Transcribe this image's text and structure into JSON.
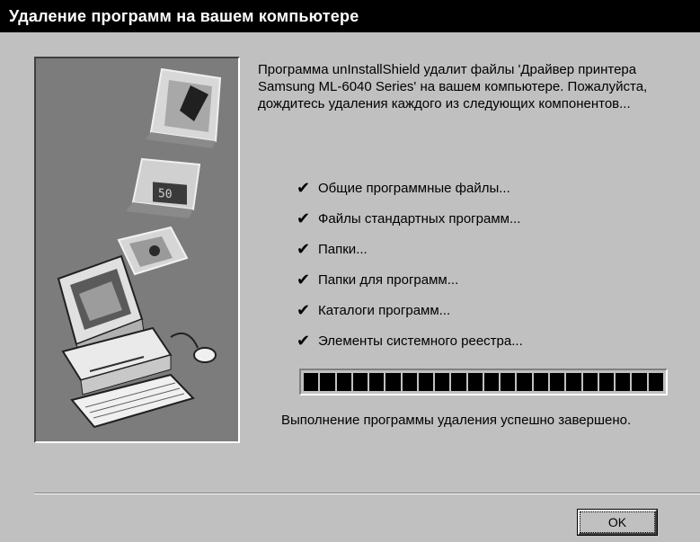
{
  "window": {
    "title": "Удаление программ на вашем компьютере"
  },
  "intro_text": "Программа unInstallShield удалит файлы 'Драйвер принтера Samsung ML-6040 Series' на вашем компьютере.  Пожалуйста, дождитесь удаления каждого из следующих компонентов...",
  "check_symbol": "✔",
  "items": [
    {
      "label": "Общие программные файлы..."
    },
    {
      "label": "Файлы стандартных программ..."
    },
    {
      "label": "Папки..."
    },
    {
      "label": "Папки для программ..."
    },
    {
      "label": "Каталоги программ..."
    },
    {
      "label": "Элементы системного реестра..."
    }
  ],
  "progress": {
    "fraction": 1.0,
    "segments": 22
  },
  "status_text": "Выполнение программы удаления успешно завершено.",
  "buttons": {
    "ok_label": "OK"
  },
  "illustration": {
    "icon": "computer-illustration",
    "display_text": "50"
  },
  "colors": {
    "titlebar": "#000000",
    "face": "#c0c0c0",
    "illustration_bg": "#7c7c7c"
  }
}
